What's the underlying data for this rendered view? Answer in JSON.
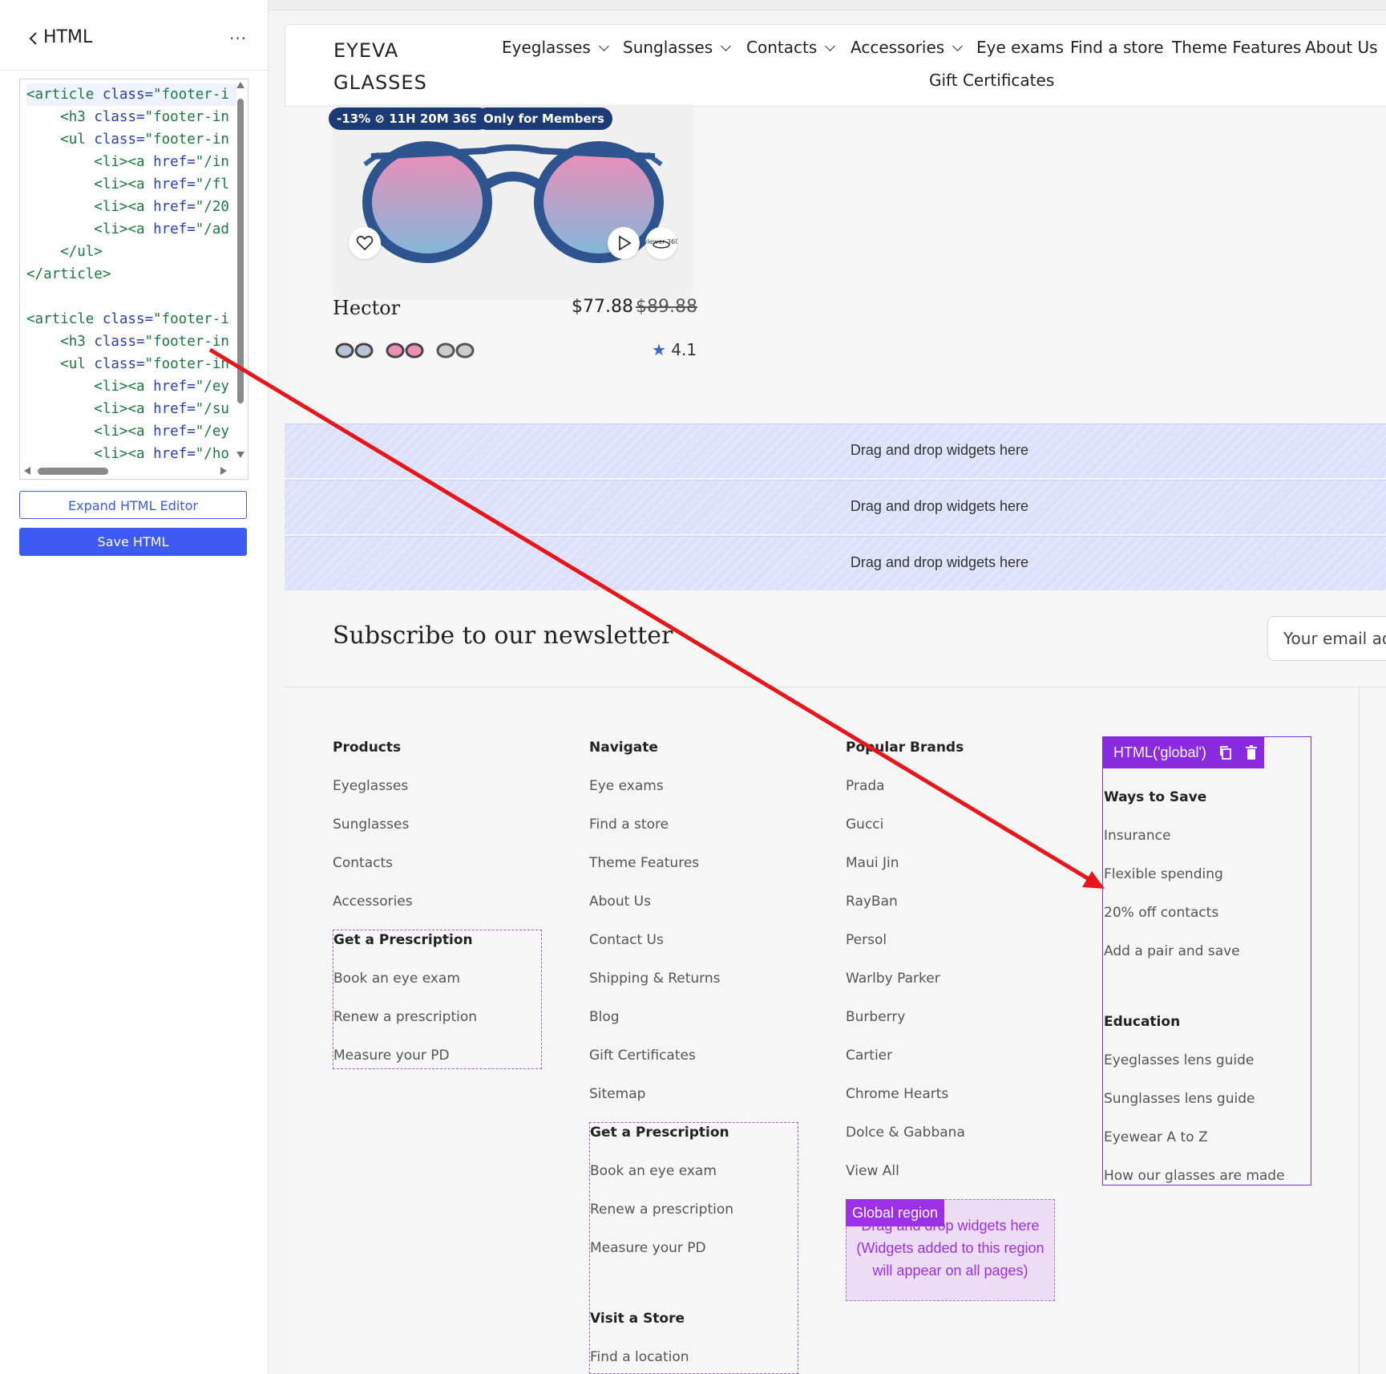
{
  "panel": {
    "title": "HTML",
    "more": "···",
    "code_lines": [
      {
        "indent": "",
        "parts": [
          [
            "tag",
            "<article "
          ],
          [
            "attr",
            "class="
          ],
          [
            "tag",
            "\"footer-i"
          ]
        ]
      },
      {
        "indent": "    ",
        "parts": [
          [
            "tag",
            "<h3 "
          ],
          [
            "attr",
            "class="
          ],
          [
            "tag",
            "\"footer-in"
          ]
        ]
      },
      {
        "indent": "    ",
        "parts": [
          [
            "tag",
            "<ul "
          ],
          [
            "attr",
            "class="
          ],
          [
            "tag",
            "\"footer-in"
          ]
        ]
      },
      {
        "indent": "        ",
        "parts": [
          [
            "tag",
            "<li><a "
          ],
          [
            "attr",
            "href="
          ],
          [
            "tag",
            "\"/in"
          ]
        ]
      },
      {
        "indent": "        ",
        "parts": [
          [
            "tag",
            "<li><a "
          ],
          [
            "attr",
            "href="
          ],
          [
            "tag",
            "\"/fl"
          ]
        ]
      },
      {
        "indent": "        ",
        "parts": [
          [
            "tag",
            "<li><a "
          ],
          [
            "attr",
            "href="
          ],
          [
            "tag",
            "\"/20"
          ]
        ]
      },
      {
        "indent": "        ",
        "parts": [
          [
            "tag",
            "<li><a "
          ],
          [
            "attr",
            "href="
          ],
          [
            "tag",
            "\"/ad"
          ]
        ]
      },
      {
        "indent": "    ",
        "parts": [
          [
            "tag",
            "</ul>"
          ]
        ]
      },
      {
        "indent": "",
        "parts": [
          [
            "tag",
            "</article>"
          ]
        ]
      },
      {
        "indent": "",
        "parts": []
      },
      {
        "indent": "",
        "parts": [
          [
            "tag",
            "<article "
          ],
          [
            "attr",
            "class="
          ],
          [
            "tag",
            "\"footer-i"
          ]
        ]
      },
      {
        "indent": "    ",
        "parts": [
          [
            "tag",
            "<h3 "
          ],
          [
            "attr",
            "class="
          ],
          [
            "tag",
            "\"footer-in"
          ]
        ]
      },
      {
        "indent": "    ",
        "parts": [
          [
            "tag",
            "<ul "
          ],
          [
            "attr",
            "class="
          ],
          [
            "tag",
            "\"footer-in"
          ]
        ]
      },
      {
        "indent": "        ",
        "parts": [
          [
            "tag",
            "<li><a "
          ],
          [
            "attr",
            "href="
          ],
          [
            "tag",
            "\"/ey"
          ]
        ]
      },
      {
        "indent": "        ",
        "parts": [
          [
            "tag",
            "<li><a "
          ],
          [
            "attr",
            "href="
          ],
          [
            "tag",
            "\"/su"
          ]
        ]
      },
      {
        "indent": "        ",
        "parts": [
          [
            "tag",
            "<li><a "
          ],
          [
            "attr",
            "href="
          ],
          [
            "tag",
            "\"/ey"
          ]
        ]
      },
      {
        "indent": "        ",
        "parts": [
          [
            "tag",
            "<li><a "
          ],
          [
            "attr",
            "href="
          ],
          [
            "tag",
            "\"/ho"
          ]
        ]
      }
    ],
    "expand_label": "Expand HTML Editor",
    "save_label": "Save HTML"
  },
  "site": {
    "logo_line1": "EYEVA",
    "logo_line2": "GLASSES",
    "nav": [
      "Eyeglasses",
      "Sunglasses",
      "Contacts",
      "Accessories",
      "Eye exams",
      "Find a store",
      "Theme Features",
      "About Us",
      "Gift Certificates"
    ]
  },
  "product": {
    "badge_discount": "-13%",
    "badge_timer": "11H 20M 36S",
    "badge_members": "Only for Members",
    "name": "Hector",
    "price_sale": "$77.88",
    "price_original": "$89.88",
    "rating": "4.1",
    "viewer_label": "viewer 360"
  },
  "drop_zones": [
    "Drag and drop widgets here",
    "Drag and drop widgets here",
    "Drag and drop widgets here"
  ],
  "newsletter": {
    "title": "Subscribe to our newsletter",
    "email_placeholder": "Your email add"
  },
  "footer": {
    "products": {
      "title": "Products",
      "links": [
        "Eyeglasses",
        "Sunglasses",
        "Contacts",
        "Accessories"
      ]
    },
    "products_prescription": {
      "title": "Get a Prescription",
      "links": [
        "Book an eye exam",
        "Renew a prescription",
        "Measure your PD"
      ]
    },
    "navigate": {
      "title": "Navigate",
      "links": [
        "Eye exams",
        "Find a store",
        "Theme Features",
        "About Us",
        "Contact Us",
        "Shipping & Returns",
        "Blog",
        "Gift Certificates",
        "Sitemap"
      ]
    },
    "navigate_prescription": {
      "title": "Get a Prescription",
      "links": [
        "Book an eye exam",
        "Renew a prescription",
        "Measure your PD"
      ]
    },
    "visit_store": {
      "title": "Visit a Store",
      "links": [
        "Find a location"
      ]
    },
    "brands": {
      "title": "Popular Brands",
      "links": [
        "Prada",
        "Gucci",
        "Maui Jin",
        "RayBan",
        "Persol",
        "Warlby Parker",
        "Burberry",
        "Cartier",
        "Chrome Hearts",
        "Dolce & Gabbana",
        "View All"
      ]
    },
    "ways_to_save": {
      "title": "Ways to Save",
      "links": [
        "Insurance",
        "Flexible spending",
        "20% off contacts",
        "Add a pair and save"
      ]
    },
    "education": {
      "title": "Education",
      "links": [
        "Eyeglasses lens guide",
        "Sunglasses lens guide",
        "Eyewear A to Z",
        "How our glasses are made"
      ]
    },
    "widget_label": "HTML('global')",
    "global_region_tag": "Global region",
    "global_region_text": "Drag and drop widgets here (Widgets added to this region will appear on all pages)"
  },
  "colors": {
    "accent": "#3d5af1",
    "badge": "#1c3a73",
    "widget": "#8a2be2",
    "arrow": "#e8151b"
  }
}
